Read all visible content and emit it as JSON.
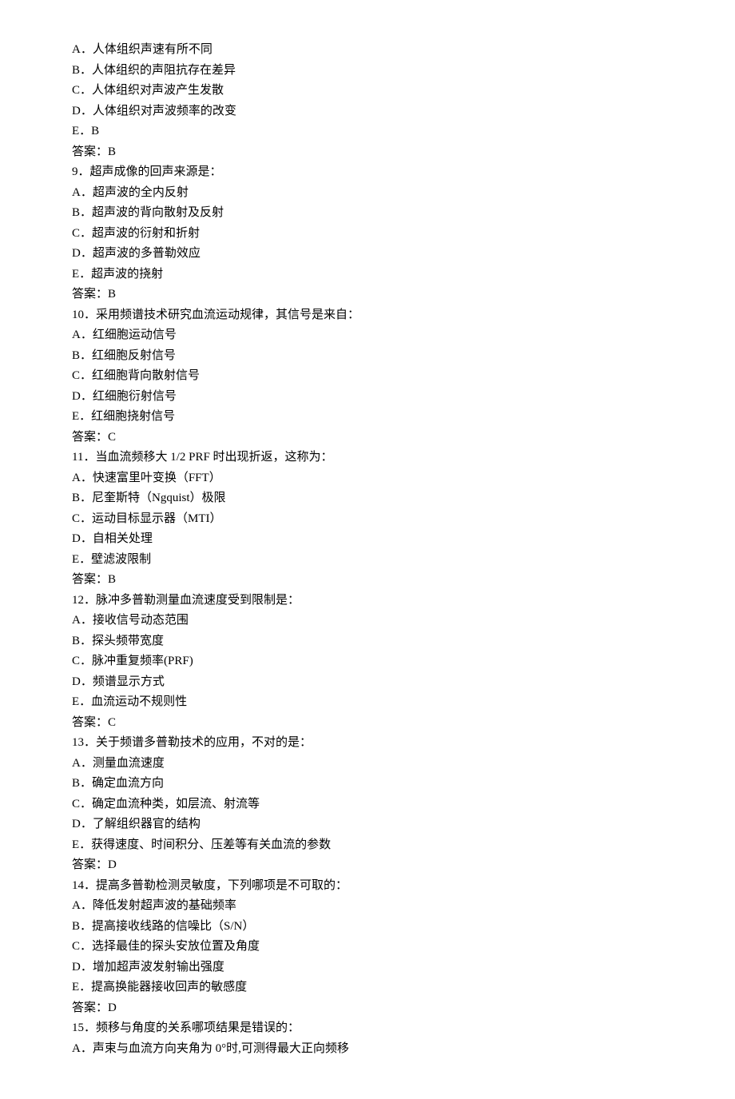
{
  "lines": [
    "A．人体组织声速有所不同",
    "B．人体组织的声阻抗存在差异",
    "C．人体组织对声波产生发散",
    "D．人体组织对声波频率的改变",
    "E．B",
    "答案：B",
    "9．超声成像的回声来源是：",
    "A．超声波的全内反射",
    "B．超声波的背向散射及反射",
    "C．超声波的衍射和折射",
    "D．超声波的多普勒效应",
    "E．超声波的挠射",
    "答案：B",
    "10．采用频谱技术研究血流运动规律，其信号是来自：",
    "A．红细胞运动信号",
    "B．红细胞反射信号",
    "C．红细胞背向散射信号",
    "D．红细胞衍射信号",
    "E．红细胞挠射信号",
    "答案：C",
    "11．当血流频移大 1/2 PRF 时出现折返，这称为：",
    "A．快速富里叶变换（FFT）",
    "B．尼奎斯特（Ngquist）极限",
    "C．运动目标显示器（MTI）",
    "D．自相关处理",
    "E．壁滤波限制",
    "答案：B",
    "12．脉冲多普勒测量血流速度受到限制是：",
    "A．接收信号动态范围",
    "B．探头频带宽度",
    "C．脉冲重复频率(PRF)",
    "D．频谱显示方式",
    "E．血流运动不规则性",
    "答案：C",
    "13．关于频谱多普勒技术的应用，不对的是：",
    "A．测量血流速度",
    "B．确定血流方向",
    "C．确定血流种类，如层流、射流等",
    "D．了解组织器官的结构",
    "E．获得速度、时间积分、压差等有关血流的参数",
    "答案：D",
    "14．提高多普勒检测灵敏度，下列哪项是不可取的：",
    "A．降低发射超声波的基础频率",
    "B．提高接收线路的信噪比（S/N）",
    "C．选择最佳的探头安放位置及角度",
    "D．增加超声波发射输出强度",
    "E．提高换能器接收回声的敏感度",
    "答案：D",
    "15．频移与角度的关系哪项结果是错误的：",
    "A．声束与血流方向夹角为 0°时,可测得最大正向频移"
  ]
}
